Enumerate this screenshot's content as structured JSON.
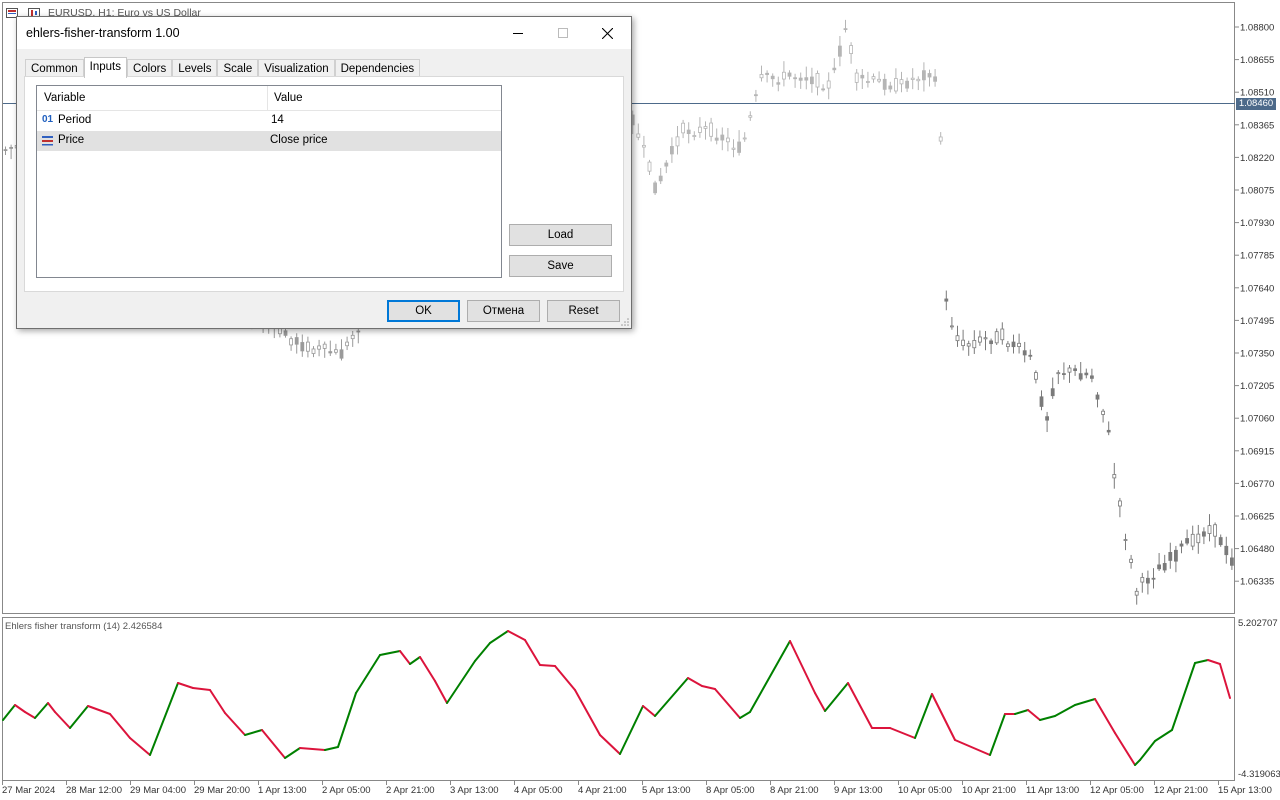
{
  "window": {
    "symbol_title": "EURUSD, H1:  Euro vs US Dollar"
  },
  "price_axis": {
    "labels": [
      "1.08800",
      "1.08655",
      "1.08510",
      "1.08365",
      "1.08220",
      "1.08075",
      "1.07930",
      "1.07785",
      "1.07640",
      "1.07495",
      "1.07350",
      "1.07205",
      "1.07060",
      "1.06915",
      "1.06770",
      "1.06625",
      "1.06480",
      "1.06335"
    ],
    "current_price": "1.08460"
  },
  "indicator": {
    "label": "Ehlers fisher transform (14) 2.426584",
    "axis_max": "5.202707",
    "axis_min": "-4.319063",
    "up_color": "#008000",
    "down_color": "#dc143c"
  },
  "time_axis": {
    "labels": [
      "27 Mar 2024",
      "28 Mar 12:00",
      "29 Mar 04:00",
      "29 Mar 20:00",
      "1 Apr 13:00",
      "2 Apr 05:00",
      "2 Apr 21:00",
      "3 Apr 13:00",
      "4 Apr 05:00",
      "4 Apr 21:00",
      "5 Apr 13:00",
      "8 Apr 05:00",
      "8 Apr 21:00",
      "9 Apr 13:00",
      "10 Apr 05:00",
      "10 Apr 21:00",
      "11 Apr 13:00",
      "12 Apr 05:00",
      "12 Apr 21:00",
      "15 Apr 13:00"
    ]
  },
  "dialog": {
    "title": "ehlers-fisher-transform 1.00",
    "tabs": [
      "Common",
      "Inputs",
      "Colors",
      "Levels",
      "Scale",
      "Visualization",
      "Dependencies"
    ],
    "active_tab": "Inputs",
    "columns": {
      "variable": "Variable",
      "value": "Value"
    },
    "rows": [
      {
        "icon": "integer-icon",
        "icon_text": "01",
        "variable": "Period",
        "value": "14"
      },
      {
        "icon": "enum-list-icon",
        "variable": "Price",
        "value": "Close price"
      }
    ],
    "buttons": {
      "load": "Load",
      "save": "Save",
      "ok": "OK",
      "cancel": "Отмена",
      "reset": "Reset"
    }
  }
}
